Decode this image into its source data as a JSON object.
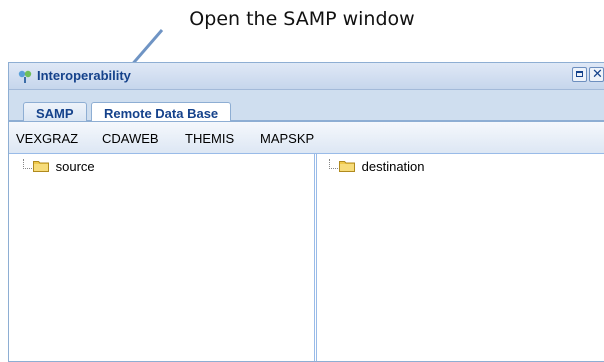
{
  "annotation": {
    "text": "Open the SAMP window"
  },
  "window": {
    "title": "Interoperability",
    "tools": [
      "maximize-icon",
      "close-icon"
    ]
  },
  "tabs": [
    {
      "label": "SAMP",
      "active": false
    },
    {
      "label": "Remote Data Base",
      "active": true
    }
  ],
  "toolbar": {
    "items": [
      "VEXGRAZ",
      "CDAWEB",
      "THEMIS",
      "MAPSKP"
    ]
  },
  "trees": {
    "source": {
      "label": "source",
      "icon": "folder-icon"
    },
    "destination": {
      "label": "destination",
      "icon": "folder-icon"
    }
  },
  "colors": {
    "title_text": "#15428b",
    "window_border": "#8eaed3",
    "arrow": "#6f94c4",
    "folder": "#f0c94a"
  }
}
